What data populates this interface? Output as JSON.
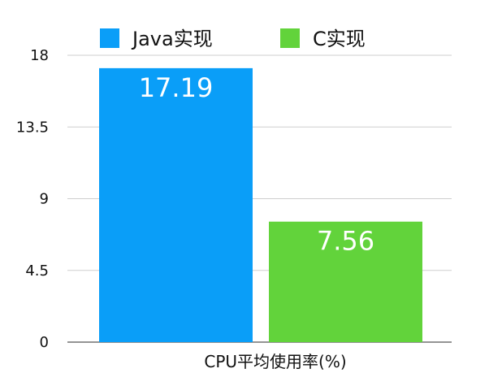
{
  "chart_data": {
    "type": "bar",
    "categories": [
      "CPU平均使用率(%)"
    ],
    "series": [
      {
        "name": "Java实现",
        "values": [
          17.19
        ],
        "color": "#0A9EF8"
      },
      {
        "name": "C实现",
        "values": [
          7.56
        ],
        "color": "#62D33B"
      }
    ],
    "ylim": [
      0,
      18
    ],
    "yticks": [
      "0",
      "4.5",
      "9",
      "13.5",
      "18"
    ],
    "data_labels": [
      "17.19",
      "7.56"
    ],
    "grid": true,
    "legend_position": "top"
  }
}
